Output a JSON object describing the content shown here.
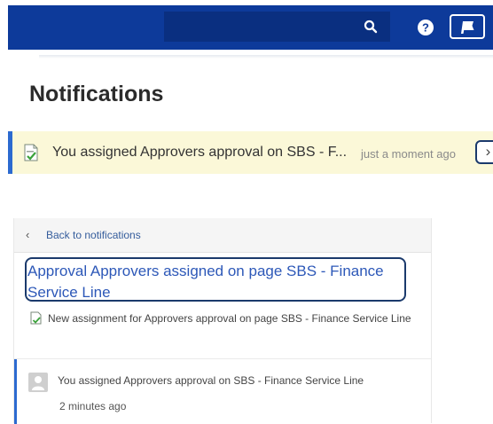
{
  "colors": {
    "header_bg": "#0d3a9a",
    "toast_bg": "#fbf8d8",
    "accent": "#2c6ad0",
    "link": "#2d58b8"
  },
  "header": {
    "icons": [
      "search-icon",
      "help-icon",
      "notification-flag-icon"
    ]
  },
  "page": {
    "title": "Notifications"
  },
  "toast": {
    "icon": "document-check-icon",
    "message": "You assigned Approvers approval on SBS - F...",
    "time": "just a moment ago",
    "action_glyph": "›"
  },
  "detail": {
    "back_label": "Back to notifications",
    "back_glyph": "‹",
    "title": "Approval Approvers assigned on page SBS - Finance Service Line",
    "description": "New assignment for Approvers approval on page SBS - Finance Service Line",
    "activity": {
      "text": "You assigned Approvers approval on SBS - Finance Service Line",
      "time": "2 minutes ago"
    }
  }
}
